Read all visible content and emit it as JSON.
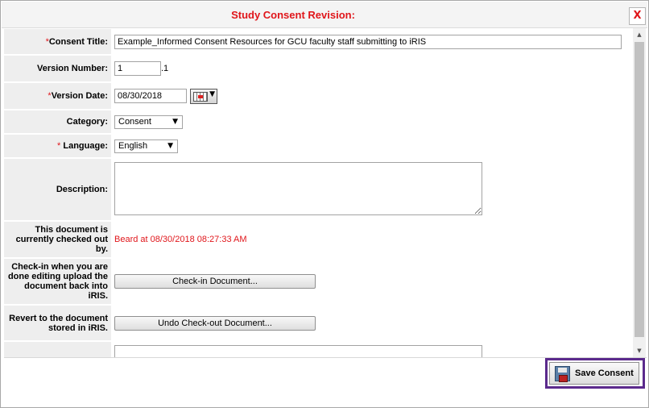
{
  "dialog": {
    "title": "Study Consent Revision:",
    "close_label": "X"
  },
  "form": {
    "consent_title": {
      "required_mark": "*",
      "label": "Consent Title:",
      "value": "Example_Informed Consent Resources for GCU faculty staff submitting to iRIS"
    },
    "version_number": {
      "label": "Version Number:",
      "value": "1",
      "suffix": ".1"
    },
    "version_date": {
      "required_mark": "*",
      "label": "Version Date:",
      "value": "08/30/2018",
      "calendar_icon": "calendar-icon"
    },
    "category": {
      "label": "Category:",
      "selected": "Consent"
    },
    "language": {
      "required_mark": "*",
      "label": "Language:",
      "selected": "English"
    },
    "description": {
      "label": "Description:",
      "value": ""
    },
    "checked_out": {
      "label": "This document is currently checked out by.",
      "value": "Beard at 08/30/2018 08:27:33 AM"
    },
    "check_in": {
      "label": "Check-in when you are done editing upload the document back into iRIS.",
      "button": "Check-in Document..."
    },
    "revert": {
      "label": "Revert to the document stored in iRIS.",
      "button": "Undo Check-out Document..."
    }
  },
  "footer": {
    "save_label": "Save Consent",
    "save_icon": "floppy-disk-icon"
  },
  "colors": {
    "title_red": "#e0161b",
    "label_bg": "#eeeeee",
    "highlight_purple": "#5b2a8c"
  }
}
